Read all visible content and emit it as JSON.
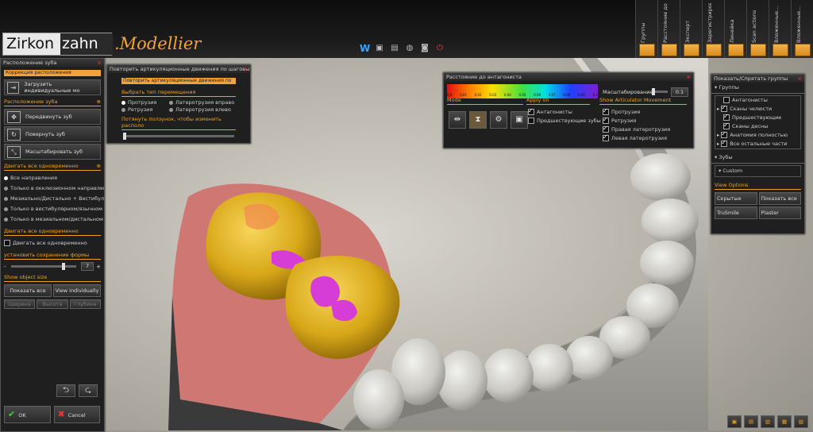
{
  "brand": {
    "logo_left": "Zirkon",
    "logo_right": "zahn",
    "product": ".Modellier"
  },
  "toolbar_icons": [
    "w-icon",
    "save-icon",
    "floppy-icon",
    "chat-icon",
    "camera-icon",
    "power-icon"
  ],
  "toolbar_w": "W",
  "top_tabs": [
    {
      "label": "Группы",
      "icon": ""
    },
    {
      "label": "Расстояние до ант...",
      "icon": ""
    },
    {
      "label": "Эксперт",
      "icon": ""
    },
    {
      "label": "Зарегистрированные...",
      "icon": ""
    },
    {
      "label": "Линейка",
      "icon": ""
    },
    {
      "label": "Scan actions",
      "icon": ""
    },
    {
      "label": "Вложенные...",
      "icon": ""
    },
    {
      "label": "Вложенные...",
      "icon": ""
    }
  ],
  "left": {
    "title": "Расположение зуба",
    "orange": "Коррекция расположения",
    "load_btn": "Загрузить индивидуальные мо",
    "sec1": "Расположение зуба",
    "move_btn": "Передвинуть зуб",
    "rotate_btn": "Повернуть зуб",
    "scale_btn": "Масштабировать зуб",
    "sec2": "Двигать все одновременно",
    "dirs": [
      "Все направления",
      "Только в окклюзионном направлен",
      "Мезиально/Дистально + Вестибуля",
      "Только в вестибулярном/язычном н",
      "Только в мезиальном/дистальном н"
    ],
    "sec3": "Двигать все одновременно",
    "move_all": "Двигать все одновременно",
    "sec4": "установить сохранение формы",
    "minus": "-",
    "plus": "+",
    "shape_val": "7",
    "sec5": "Show object size",
    "show_all": "Показать все",
    "view_ind": "View individually",
    "cols": [
      "Ширина",
      "Высота",
      "Глубина"
    ],
    "ok": "OK",
    "cancel": "Cancel"
  },
  "mid": {
    "title": "Повторить артикуляционные движения по шаговы",
    "orange": "Повторить артикуляционные движения по ш",
    "sec": "Выбрать тип перемещения",
    "r1": "Протрузия",
    "r2": "Ретрузия",
    "r3": "Латеротрузия вправо",
    "r4": "Латеротрузия влево",
    "hint": "Потянуть ползунок, чтобы изменить располо"
  },
  "dist": {
    "title": "Расстояние до антагониста",
    "scale_label": "Масштабирование",
    "scale_val": "0.1",
    "ticks": [
      "0.0",
      "0.01",
      "0.02",
      "0.03",
      "0.04",
      "0.05",
      "0.06",
      "0.07",
      "0.08",
      "0.09",
      "0.1"
    ],
    "mode": "Mode",
    "apply": "Apply on",
    "apply_items": [
      "Антагонисты",
      "Предшествующие зубы"
    ],
    "sam": "Show Articulator Movement",
    "sam_items": [
      "Протрузия",
      "Ретрузия",
      "Правая латеротрузия",
      "Левая латеротрузия"
    ]
  },
  "groups": {
    "title": "Показать/Спрятать группы",
    "sec1": "Группы",
    "items": [
      "Антагонисты",
      "Сканы челюсти",
      "Предшествующие",
      "Сканы десны",
      "Анатомия полностью",
      "Все остальные части"
    ],
    "sec2": "Зубы",
    "custom": "Custom",
    "sec3": "View Options",
    "b1": "Скрытые",
    "b2": "Показать все",
    "b3": "TruSmile",
    "b4": "Plaster"
  }
}
